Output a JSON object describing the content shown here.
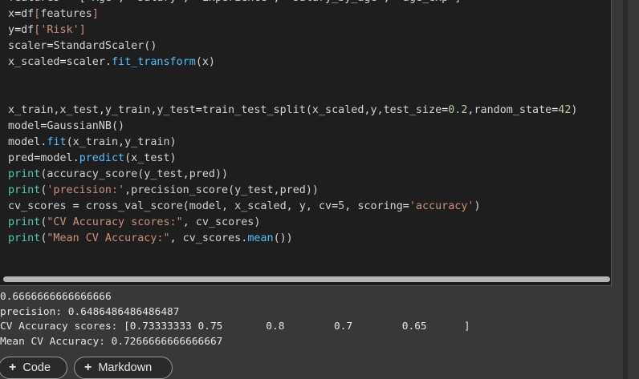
{
  "code_lines": [
    [
      [
        "features = ['Age', 'Salary', 'Experience', 'salary_by_age', 'age_exp']",
        "br"
      ]
    ],
    [
      [
        "x",
        "br"
      ],
      [
        "=",
        "op"
      ],
      [
        "df",
        "br"
      ],
      [
        "[",
        "str"
      ],
      [
        "features",
        "br"
      ],
      [
        "]",
        "str"
      ]
    ],
    [
      [
        "y",
        "br"
      ],
      [
        "=",
        "op"
      ],
      [
        "df",
        "br"
      ],
      [
        "[",
        "str"
      ],
      [
        "'Risk'",
        "str"
      ],
      [
        "]",
        "str"
      ]
    ],
    [
      [
        "scaler",
        "br"
      ],
      [
        "=",
        "op"
      ],
      [
        "StandardScaler()",
        "br"
      ]
    ],
    [
      [
        "x_scaled",
        "br"
      ],
      [
        "=",
        "op"
      ],
      [
        "scaler.",
        "br"
      ],
      [
        "fit_transform",
        "fn"
      ],
      [
        "(x)",
        "br"
      ]
    ],
    [
      [
        "",
        "br"
      ]
    ],
    [
      [
        "",
        "br"
      ]
    ],
    [
      [
        "x_train,x_test,y_train,y_test",
        "br"
      ],
      [
        "=",
        "op"
      ],
      [
        "train_test_split(x_scaled,y,test_size",
        "br"
      ],
      [
        "=",
        "op"
      ],
      [
        "0.2",
        "num"
      ],
      [
        ",random_state",
        "br"
      ],
      [
        "=",
        "op"
      ],
      [
        "42",
        "num"
      ],
      [
        ")",
        "br"
      ]
    ],
    [
      [
        "model",
        "br"
      ],
      [
        "=",
        "op"
      ],
      [
        "GaussianNB()",
        "br"
      ]
    ],
    [
      [
        "model.",
        "br"
      ],
      [
        "fit",
        "fn"
      ],
      [
        "(x_train,y_train)",
        "br"
      ]
    ],
    [
      [
        "pred",
        "br"
      ],
      [
        "=",
        "op"
      ],
      [
        "model.",
        "br"
      ],
      [
        "predict",
        "fn"
      ],
      [
        "(x_test)",
        "br"
      ]
    ],
    [
      [
        "print",
        "kw"
      ],
      [
        "(accuracy_score(y_test,pred))",
        "br"
      ]
    ],
    [
      [
        "print",
        "kw"
      ],
      [
        "(",
        "br"
      ],
      [
        "'precision:'",
        "str"
      ],
      [
        ",precision_score(y_test,pred))",
        "br"
      ]
    ],
    [
      [
        "cv_scores ",
        "br"
      ],
      [
        "=",
        "op"
      ],
      [
        " cross_val_score(model, x_scaled, y, cv",
        "br"
      ],
      [
        "=",
        "op"
      ],
      [
        "5",
        "num"
      ],
      [
        ", scoring",
        "br"
      ],
      [
        "=",
        "op"
      ],
      [
        "'accuracy'",
        "str"
      ],
      [
        ")",
        "br"
      ]
    ],
    [
      [
        "print",
        "kw"
      ],
      [
        "(",
        "br"
      ],
      [
        "\"CV Accuracy scores:\"",
        "str"
      ],
      [
        ", cv_scores)",
        "br"
      ]
    ],
    [
      [
        "print",
        "kw"
      ],
      [
        "(",
        "br"
      ],
      [
        "\"Mean CV Accuracy:\"",
        "str"
      ],
      [
        ", cv_scores.",
        "br"
      ],
      [
        "mean",
        "fn"
      ],
      [
        "())",
        "br"
      ]
    ]
  ],
  "output_lines": [
    "0.6666666666666666",
    "precision: 0.6486486486486487",
    "CV Accuracy scores: [0.73333333 0.75       0.8        0.7        0.65      ]",
    "Mean CV Accuracy: 0.7266666666666667"
  ],
  "buttons": {
    "add_code_label": "Code",
    "add_markdown_label": "Markdown"
  },
  "colors": {
    "background": "#383838",
    "cell_background": "#1e1e1e",
    "string": "#ce9178",
    "function": "#4fc1ff",
    "builtin": "#4ec9b0",
    "number": "#b5cea8"
  }
}
